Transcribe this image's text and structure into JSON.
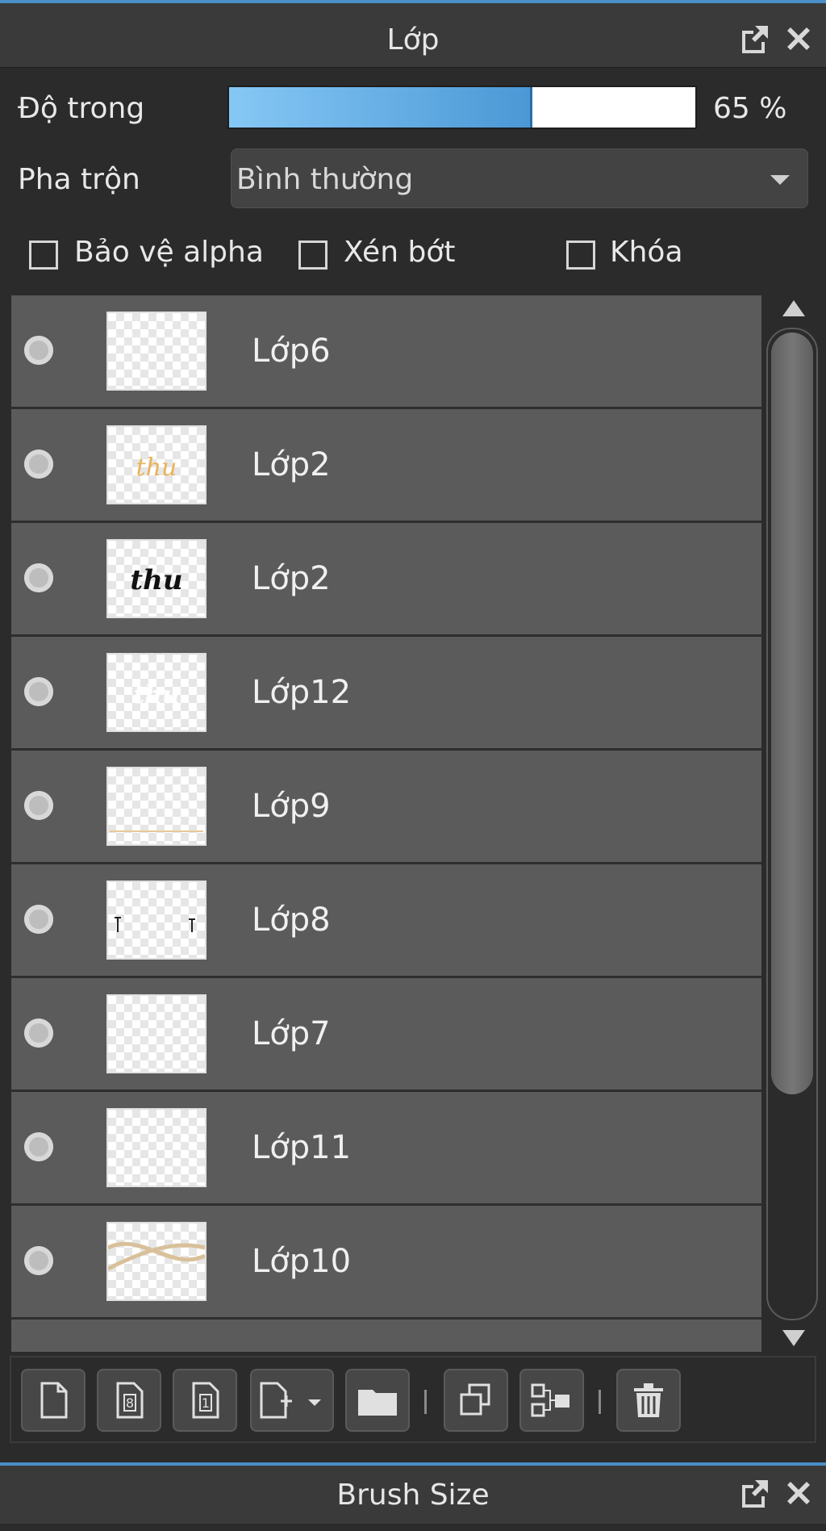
{
  "panel": {
    "title": "Lớp",
    "popout_icon": "popout-icon",
    "close_icon": "close-icon"
  },
  "opacity": {
    "label": "Độ trong",
    "value": 65,
    "value_text": "65 %",
    "fill_color": "#5aa8e6"
  },
  "blend": {
    "label": "Pha trộn",
    "selected": "Bình thường"
  },
  "options": {
    "protect_alpha": {
      "label": "Bảo vệ alpha",
      "checked": false
    },
    "clipping": {
      "label": "Xén bớt",
      "checked": false
    },
    "lock": {
      "label": "Khóa",
      "checked": false
    }
  },
  "layers": [
    {
      "name": "Lớp6",
      "thumb": "empty"
    },
    {
      "name": "Lớp2",
      "thumb": "thu-gold"
    },
    {
      "name": "Lớp2",
      "thumb": "thu-black"
    },
    {
      "name": "Lớp12",
      "thumb": "thu-white"
    },
    {
      "name": "Lớp9",
      "thumb": "line"
    },
    {
      "name": "Lớp8",
      "thumb": "pins"
    },
    {
      "name": "Lớp7",
      "thumb": "empty"
    },
    {
      "name": "Lớp11",
      "thumb": "empty"
    },
    {
      "name": "Lớp10",
      "thumb": "ribbon"
    }
  ],
  "toolbar": {
    "buttons": [
      "new-layer-icon",
      "new-8bit-layer-icon",
      "new-1bit-layer-icon",
      "add-layer-dropdown-icon",
      "new-folder-icon",
      "duplicate-layer-icon",
      "merge-down-icon",
      "delete-layer-icon"
    ]
  },
  "next_panel": {
    "title": "Brush Size"
  }
}
